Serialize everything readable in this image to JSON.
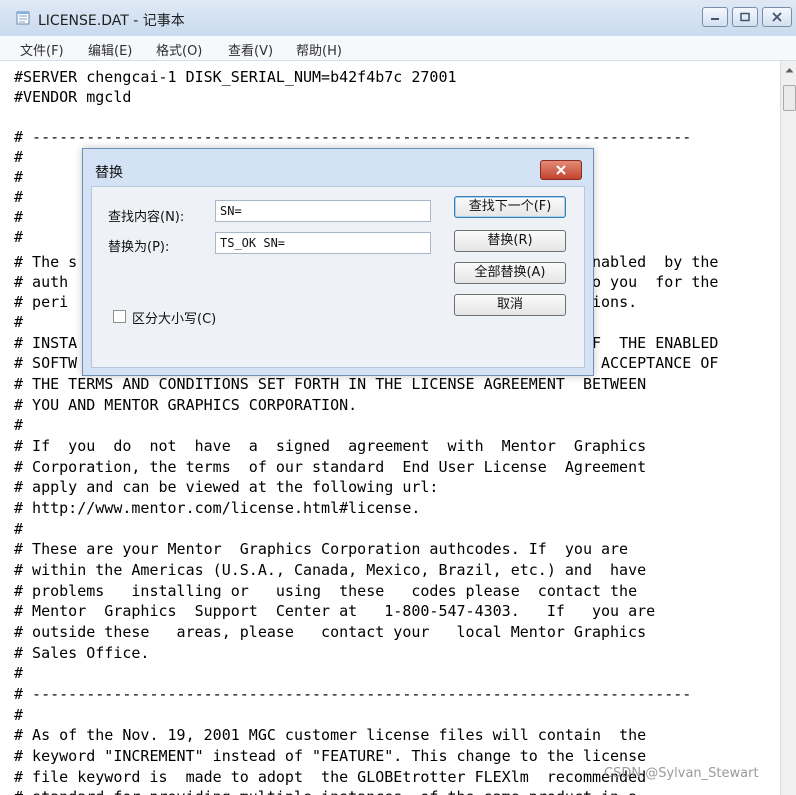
{
  "window": {
    "title": "LICENSE.DAT - 记事本",
    "icon": "notepad-icon"
  },
  "menu": [
    "文件(F)",
    "编辑(E)",
    "格式(O)",
    "查看(V)",
    "帮助(H)"
  ],
  "editor": {
    "full_lines": [
      "#SERVER chengcai-1 DISK_SERIAL_NUM=b42f4b7c 27001",
      "#VENDOR mgcld",
      "",
      "# -------------------------------------------------------------------------",
      "#",
      "#",
      "#",
      "#",
      "#",
      "# The s",
      "# auth",
      "# peri",
      "#",
      "# INSTA",
      "# SOFTW",
      "# THE TERMS AND CONDITIONS SET FORTH IN THE LICENSE AGREEMENT  BETWEEN",
      "# YOU AND MENTOR GRAPHICS CORPORATION.",
      "#",
      "# If  you  do  not  have  a  signed  agreement  with  Mentor  Graphics",
      "# Corporation, the terms  of our standard  End User License  Agreement",
      "# apply and can be viewed at the following url:",
      "# http://www.mentor.com/license.html#license.",
      "#",
      "# These are your Mentor  Graphics Corporation authcodes. If  you are",
      "# within the Americas (U.S.A., Canada, Mexico, Brazil, etc.) and  have",
      "# problems   installing or   using  these   codes please  contact the",
      "# Mentor  Graphics  Support  Center at   1-800-547-4303.   If   you are",
      "# outside these   areas, please   contact your   local Mentor Graphics",
      "# Sales Office.",
      "#",
      "# -------------------------------------------------------------------------",
      "#",
      "# As of the Nov. 19, 2001 MGC customer license files will contain  the",
      "# keyword \"INCREMENT\" instead of \"FEATURE\". This change to the license",
      "# file keyword is  made to adopt  the GLOBEtrotter FLEXlm  recommended",
      "# standard for providing multiple instances  of the same product in a"
    ],
    "right_fragments": [
      {
        "line": 9,
        "text": "nabled  by the"
      },
      {
        "line": 10,
        "text": "o you  for the"
      },
      {
        "line": 11,
        "text": "ions."
      },
      {
        "line": 13,
        "text": "F  THE ENABLED"
      },
      {
        "line": 14,
        "text": " ACCEPTANCE OF"
      }
    ]
  },
  "dialog": {
    "title": "替换",
    "find_label": "查找内容(N):",
    "find_value": "SN=",
    "replace_label": "替换为(P):",
    "replace_value": "TS_OK SN=",
    "find_next_button": "查找下一个(F)",
    "replace_button": "替换(R)",
    "replace_all_button": "全部替换(A)",
    "cancel_button": "取消",
    "match_case_label": "区分大小写(C)"
  },
  "watermark": "CSDN @Sylvan_Stewart"
}
